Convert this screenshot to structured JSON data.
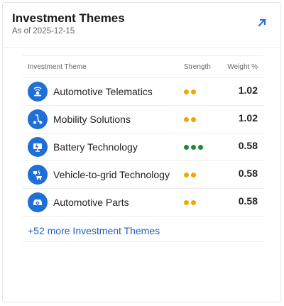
{
  "card": {
    "title": "Investment Themes",
    "subtitle": "As of 2025-12-15",
    "expand_icon": "arrow-up-right-icon"
  },
  "table": {
    "headers": {
      "theme": "Investment Theme",
      "strength": "Strength",
      "weight": "Weight %"
    },
    "rows": [
      {
        "name": "Automotive Telematics",
        "icon": "telematics-icon",
        "strength": 2,
        "strength_color": "#f0a800",
        "weight": "1.02"
      },
      {
        "name": "Mobility Solutions",
        "icon": "scooter-icon",
        "strength": 2,
        "strength_color": "#f0a800",
        "weight": "1.02"
      },
      {
        "name": "Battery Technology",
        "icon": "battery-icon",
        "strength": 3,
        "strength_color": "#1f8a3a",
        "weight": "0.58"
      },
      {
        "name": "Vehicle-to-grid Technology",
        "icon": "vehicle-grid-icon",
        "strength": 2,
        "strength_color": "#f0a800",
        "weight": "0.58"
      },
      {
        "name": "Automotive Parts",
        "icon": "car-parts-icon",
        "strength": 2,
        "strength_color": "#f0a800",
        "weight": "0.58"
      }
    ]
  },
  "more_link": "+52 more Investment Themes",
  "colors": {
    "accent": "#1f6fd6",
    "link": "#1f5fb8",
    "medium": "#f0a800",
    "strong": "#1f8a3a"
  }
}
